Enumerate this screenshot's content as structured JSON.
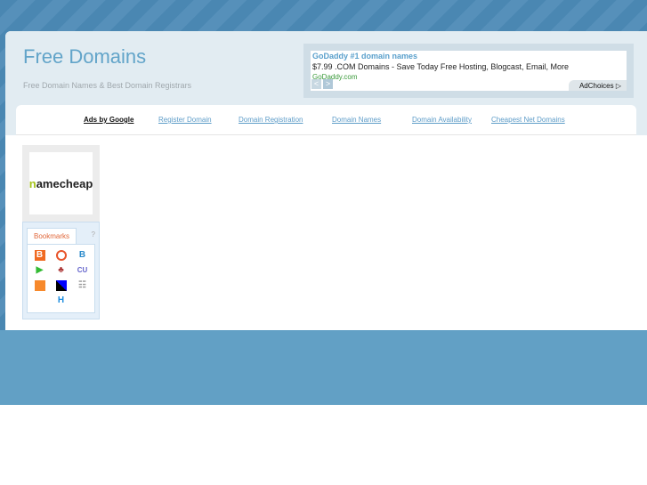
{
  "header": {
    "title": "Free Domains",
    "tagline": "Free Domain Names & Best Domain Registrars"
  },
  "ad": {
    "title": "GoDaddy #1 domain names",
    "text": "$7.99 .COM Domains - Save Today Free Hosting, Blogcast, Email, More",
    "url": "GoDaddy.com",
    "adchoices": "AdChoices ▷",
    "prev": "<",
    "next": ">"
  },
  "nav": {
    "ads_by_google": "Ads by Google",
    "links": [
      "Register Domain",
      "Domain Registration",
      "Domain Names",
      "Domain Availability",
      "Cheapest Net Domains"
    ]
  },
  "sidebar": {
    "logo_text_a": "n",
    "logo_text_b": "amecheap",
    "bookmarks_tab": "Bookmarks",
    "help": "?"
  },
  "colors": {
    "accent": "#62a4c9"
  }
}
